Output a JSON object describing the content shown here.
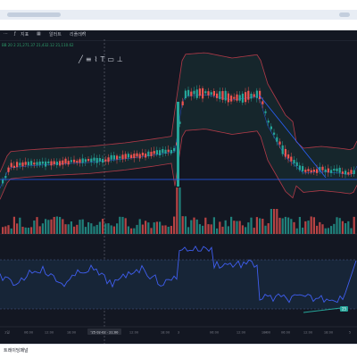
{
  "toolbar": {
    "indicator_label": "지표",
    "alert_label": "알러트",
    "replay_label": "리플레이",
    "undo_icon": "undo-icon"
  },
  "legend": {
    "text": "BB 20 2  21,271.37  21,432.12  21,110.62"
  },
  "drawing_tools": [
    "trend-line-icon",
    "fib-icon",
    "pattern-icon",
    "text-icon",
    "measure-icon",
    "lock-icon"
  ],
  "time_axis": {
    "labels": [
      "2일",
      "06:00",
      "12:00",
      "18:00",
      "'25 02-02 · 21:00",
      "12:00",
      "18:00",
      "3",
      "06:00",
      "12:00",
      "18:00",
      "4",
      "06:00",
      "12:00",
      "18:00",
      "5"
    ],
    "crosshair_label": "'25 02-02 · 21:00"
  },
  "rsi": {
    "badge": "25"
  },
  "bottom_bar": {
    "label": "트레이딩패널"
  },
  "colors": {
    "background": "#131722",
    "up": "#26a69a",
    "down": "#ef5350",
    "bb_band": "#b23a48",
    "bb_fill": "#1b3a3a",
    "basis": "#2962ff",
    "rsi": "#3f5ef0",
    "rsi_zone": "#172537"
  }
}
